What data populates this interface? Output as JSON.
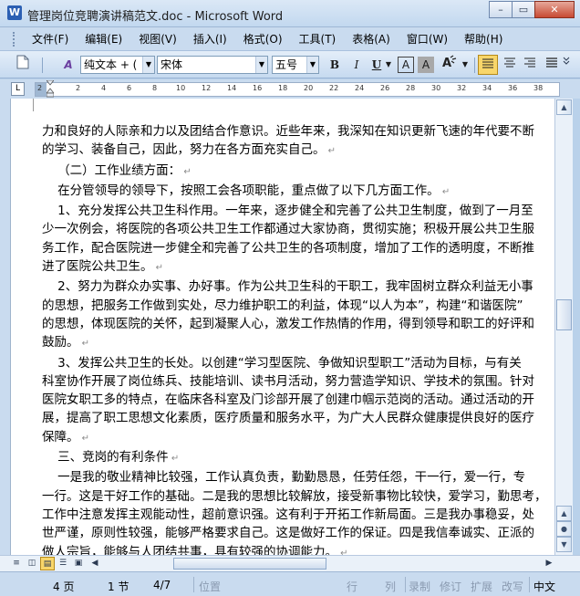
{
  "window": {
    "title": "管理岗位竞聘演讲稿范文.doc - Microsoft Word",
    "app_icon": "W",
    "minimize": "–",
    "maximize": "▭",
    "close": "✕"
  },
  "menu": [
    "文件(F)",
    "编辑(E)",
    "视图(V)",
    "插入(I)",
    "格式(O)",
    "工具(T)",
    "表格(A)",
    "窗口(W)",
    "帮助(H)"
  ],
  "toolbar": {
    "style_value": "纯文本 + (",
    "font_value": "宋体",
    "size_value": "五号",
    "bold": "B",
    "italic": "I",
    "underline": "U",
    "char_border": "A",
    "char_shading": "A",
    "style_icon": "A"
  },
  "ruler": {
    "corner": "L",
    "ticks": [
      "2",
      "2",
      "4",
      "6",
      "8",
      "10",
      "12",
      "14",
      "16",
      "18",
      "20",
      "22",
      "24",
      "26",
      "28",
      "30",
      "32",
      "34",
      "36",
      "38"
    ]
  },
  "document": {
    "lines": [
      "力和良好的人际亲和力以及团结合作意识。近些年来，我深知在知识更新飞速的年代要不断",
      "的学习、装备自己，因此，努力在各方面充实自己。",
      "    （二）工作业绩方面：",
      "    在分管领导的领导下，按照工会各项职能，重点做了以下几方面工作。",
      "    1、充分发挥公共卫生科作用。一年来，逐步健全和完善了公共卫生制度，做到了一月至",
      "少一次例会，将医院的各项公共卫生工作都通过大家协商，贯彻实施；积极开展公共卫生服",
      "务工作，配合医院进一步健全和完善了公共卫生的各项制度，增加了工作的透明度，不断推",
      "进了医院公共卫生。",
      "    2、努力为群众办实事、办好事。作为公共卫生科的干职工，我牢固树立群众利益无小事",
      "的思想，把服务工作做到实处，尽力维护职工的利益，体现“以人为本”，构建“和谐医院”",
      "的思想，体现医院的关怀，起到凝聚人心，激发工作热情的作用，得到领导和职工的好评和",
      "鼓励。",
      "    3、发挥公共卫生的长处。以创建“学习型医院、争做知识型职工”活动为目标，与有关",
      "科室协作开展了岗位练兵、技能培训、读书月活动，努力营造学知识、学技术的氛围。针对",
      "医院女职工多的特点，在临床各科室及门诊部开展了创建巾帼示范岗的活动。通过活动的开",
      "展，提高了职工思想文化素质，医疗质量和服务水平，为广大人民群众健康提供良好的医疗",
      "保障。",
      "    三、竞岗的有利条件",
      "    一是我的敬业精神比较强，工作认真负责，勤勤恳恳，任劳任怨，干一行，爱一行，专",
      "一行。这是干好工作的基础。二是我的思想比较解放，接受新事物比较快，爱学习，勤思考，",
      "工作中注意发挥主观能动性，超前意识强。这有利于开拓工作新局面。三是我办事稳妥，处",
      "世严谨，原则性较强，能够严格要求自己。这是做好工作的保证。四是我信奉诚实、正派的",
      "做人宗旨，能够与人团结共事，具有较强的协调能力。"
    ],
    "paragraph_ends": [
      1,
      2,
      3,
      7,
      11,
      16,
      17,
      22
    ]
  },
  "status": {
    "page": "4 页",
    "section": "1 节",
    "page_of": "4/7",
    "position": "位置",
    "line": "行",
    "column": "列",
    "rec": "录制",
    "trk": "修订",
    "ext": "扩展",
    "ovr": "改写",
    "language": "中文"
  }
}
